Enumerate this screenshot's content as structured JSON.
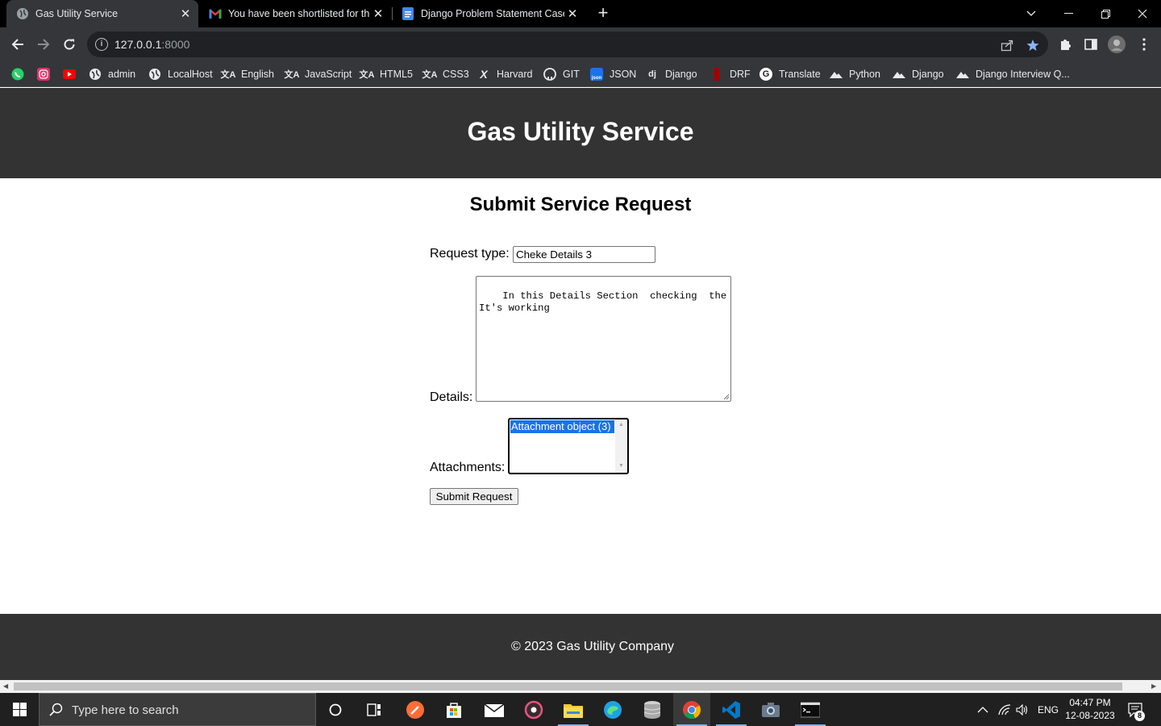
{
  "browser": {
    "tabs": [
      {
        "title": "Gas Utility Service",
        "active": true,
        "icon": "globe-icon"
      },
      {
        "title": "You have been shortlisted for the",
        "active": false,
        "icon": "gmail-icon"
      },
      {
        "title": "Django Problem Statement Case",
        "active": false,
        "icon": "docs-icon"
      }
    ],
    "url": {
      "host": "127.0.0.1",
      "port": ":8000"
    },
    "bookmarks": [
      {
        "label": "",
        "icon": "whatsapp-icon"
      },
      {
        "label": "",
        "icon": "instagram-icon"
      },
      {
        "label": "",
        "icon": "youtube-icon"
      },
      {
        "label": "admin",
        "icon": "globe-icon"
      },
      {
        "label": "LocalHost",
        "icon": "globe-icon"
      },
      {
        "label": "English",
        "icon": "translate-icon"
      },
      {
        "label": "JavaScript",
        "icon": "translate-icon"
      },
      {
        "label": "HTML5",
        "icon": "translate-icon"
      },
      {
        "label": "CSS3",
        "icon": "translate-icon"
      },
      {
        "label": "Harvard",
        "icon": "edx-icon"
      },
      {
        "label": "GIT",
        "icon": "github-icon"
      },
      {
        "label": "JSON",
        "icon": "json-icon"
      },
      {
        "label": "Django",
        "icon": "django-icon"
      },
      {
        "label": "DRF",
        "icon": "drf-icon"
      },
      {
        "label": "Translate",
        "icon": "google-icon"
      },
      {
        "label": "Python",
        "icon": "mountain-icon"
      },
      {
        "label": "Django",
        "icon": "mountain-icon"
      },
      {
        "label": "Django Interview Q...",
        "icon": "mountain-icon"
      }
    ]
  },
  "page": {
    "site_title": "Gas Utility Service",
    "form_title": "Submit Service Request",
    "request_type_label": "Request type:",
    "request_type_value": "Cheke Details 3",
    "details_label": "Details:",
    "details_value": "In this Details Section  checking  the\nIt's working",
    "attachments_label": "Attachments:",
    "attachments_options": [
      "Attachment object (3)"
    ],
    "submit_label": "Submit Request",
    "footer": "© 2023 Gas Utility Company"
  },
  "taskbar": {
    "search_placeholder": "Type here to search",
    "language": "ENG",
    "time": "04:47 PM",
    "date": "12-08-2023",
    "notifications": "8"
  }
}
